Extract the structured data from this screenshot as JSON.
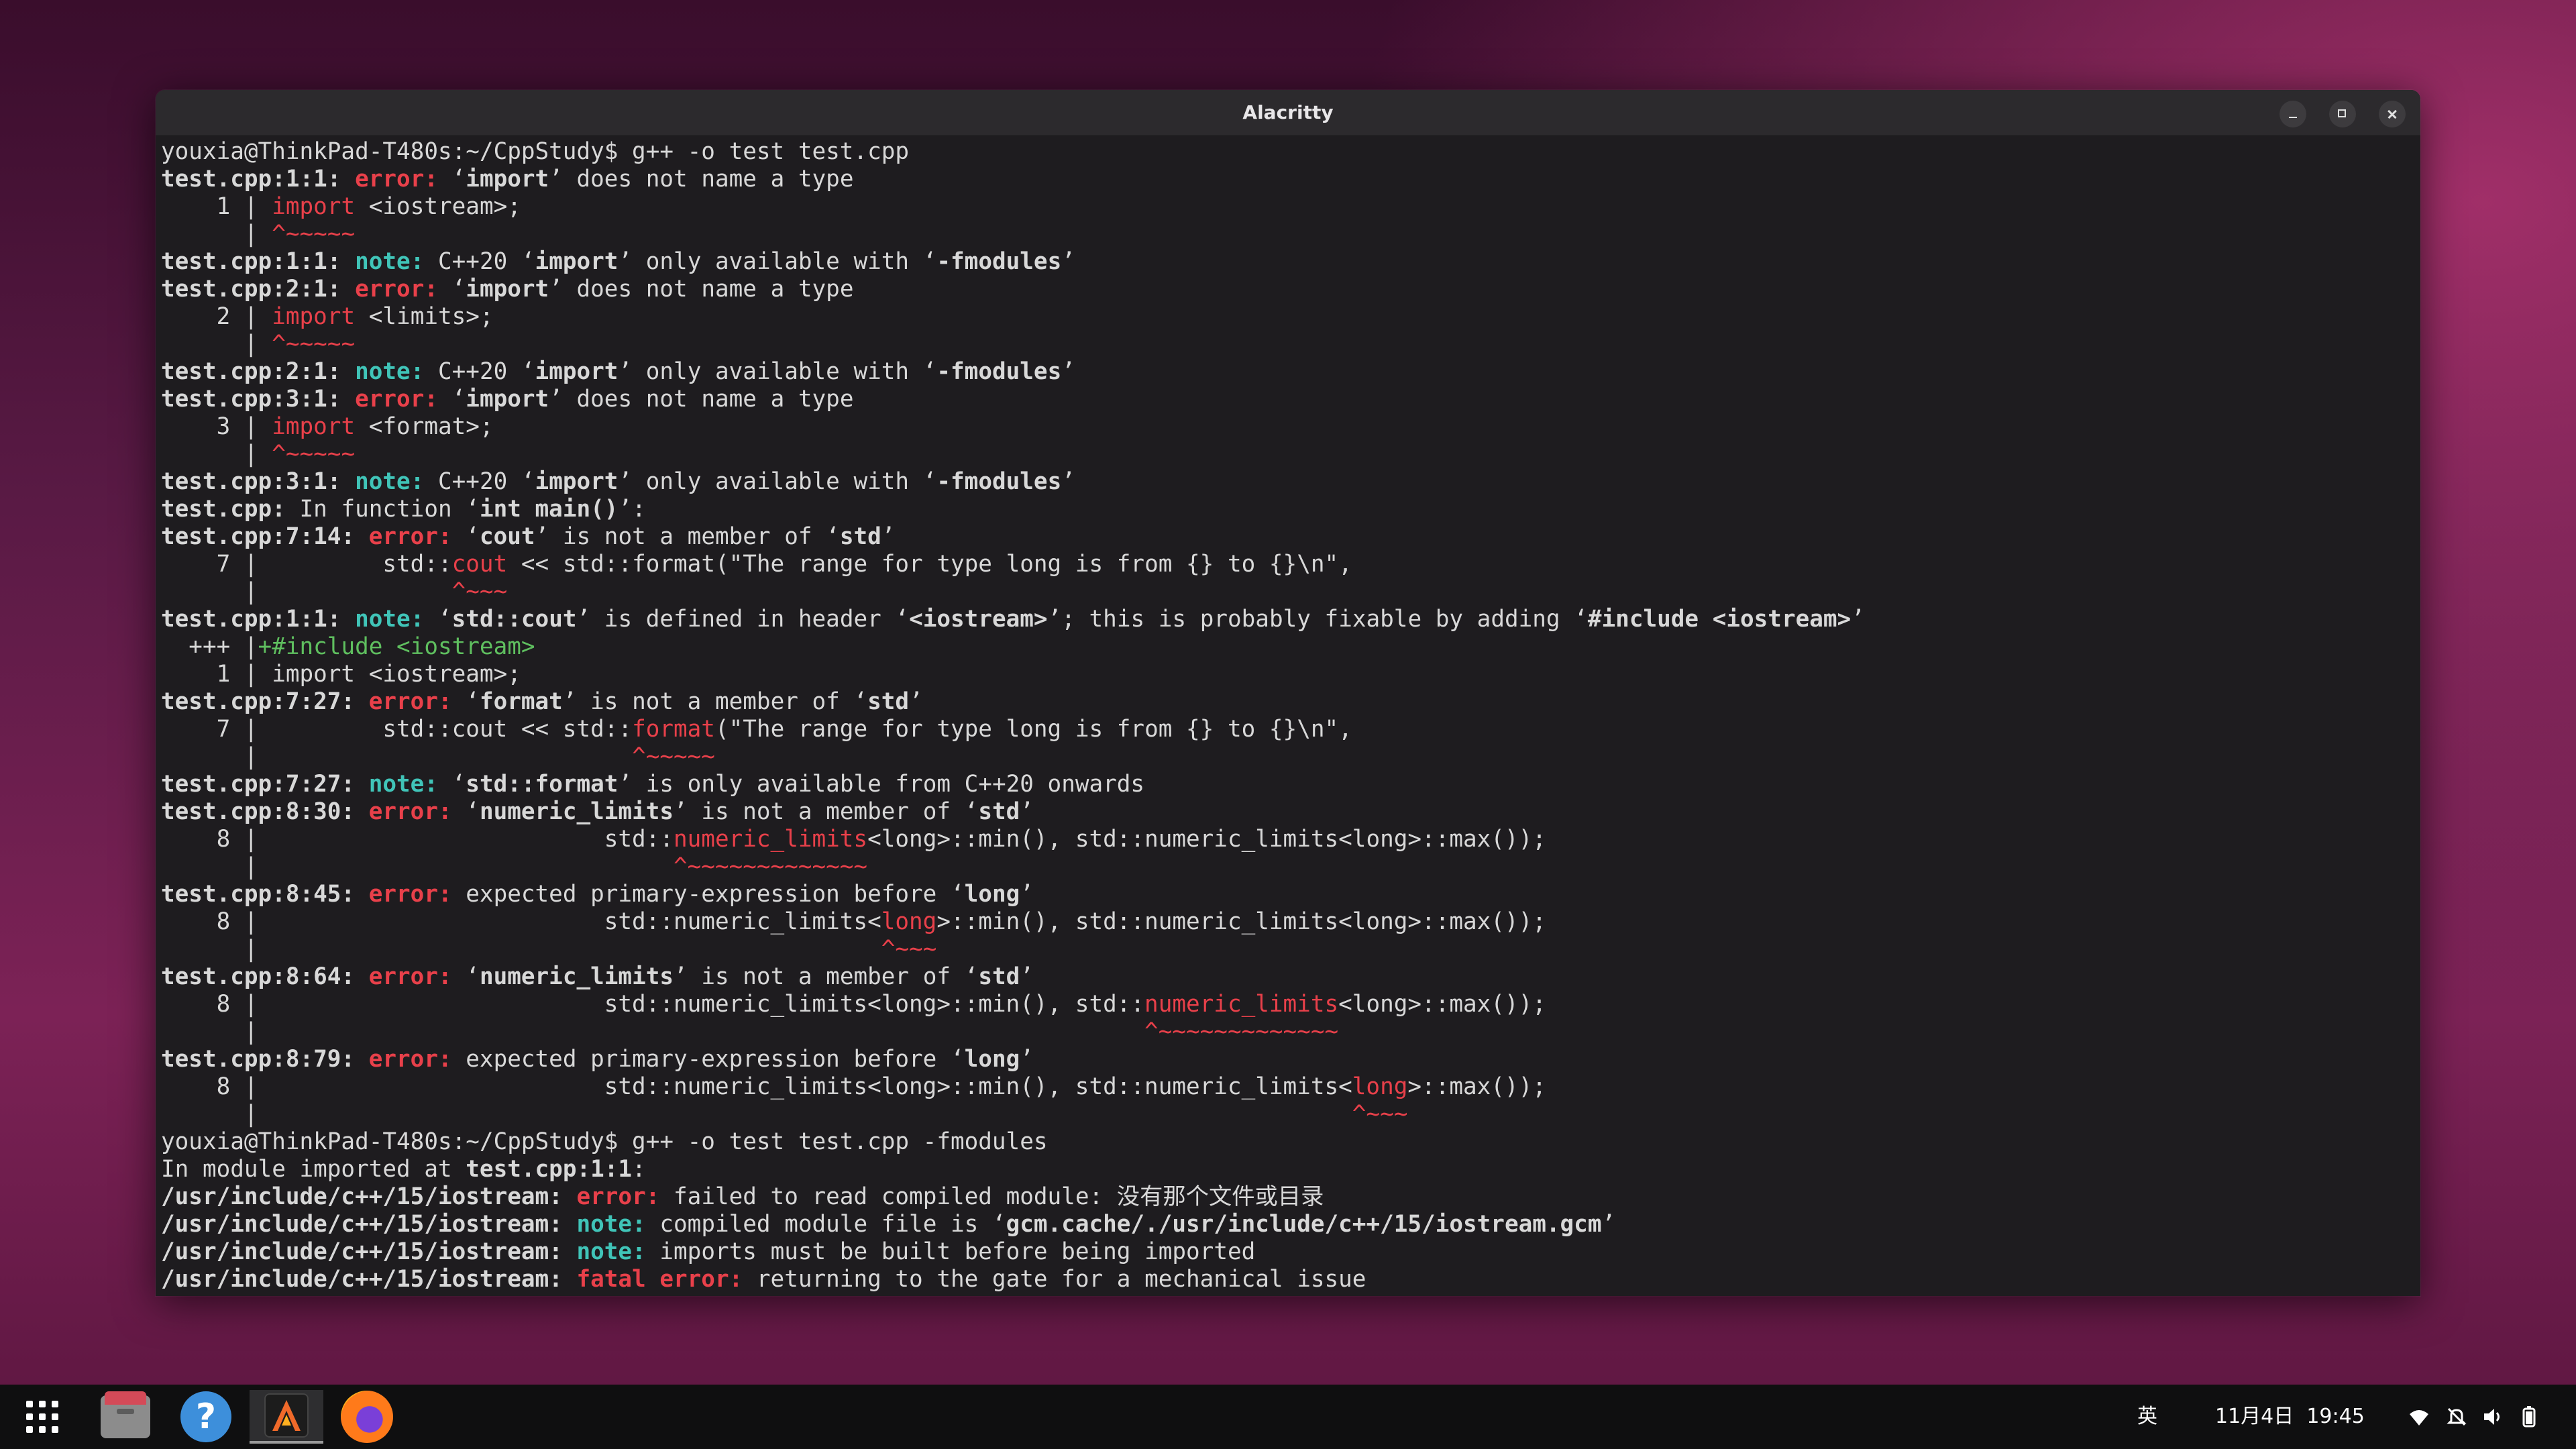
{
  "window": {
    "title": "Alacritty"
  },
  "terminal": {
    "colors": {
      "error": "#e8404a",
      "note": "#40c4b8",
      "fixit": "#5fbf5f",
      "text": "#d8d8d8"
    },
    "lines": [
      [
        {
          "t": "youxia@ThinkPad-T480s:~/CppStudy$ g++ -o test test.cpp"
        }
      ],
      [
        {
          "t": "test.cpp:1:1: ",
          "c": "bold"
        },
        {
          "t": "error: ",
          "c": "err"
        },
        {
          "t": "‘"
        },
        {
          "t": "import",
          "c": "bold"
        },
        {
          "t": "’ does not name a type"
        }
      ],
      [
        {
          "t": "    1 | "
        },
        {
          "t": "import",
          "c": "red"
        },
        {
          "t": " <iostream>;"
        }
      ],
      [
        {
          "t": "      | "
        },
        {
          "t": "^~~~~~",
          "c": "red"
        }
      ],
      [
        {
          "t": "test.cpp:1:1: ",
          "c": "bold"
        },
        {
          "t": "note: ",
          "c": "note"
        },
        {
          "t": "C++20 ‘"
        },
        {
          "t": "import",
          "c": "bold"
        },
        {
          "t": "’ only available with ‘"
        },
        {
          "t": "-fmodules",
          "c": "bold"
        },
        {
          "t": "’"
        }
      ],
      [
        {
          "t": "test.cpp:2:1: ",
          "c": "bold"
        },
        {
          "t": "error: ",
          "c": "err"
        },
        {
          "t": "‘"
        },
        {
          "t": "import",
          "c": "bold"
        },
        {
          "t": "’ does not name a type"
        }
      ],
      [
        {
          "t": "    2 | "
        },
        {
          "t": "import",
          "c": "red"
        },
        {
          "t": " <limits>;"
        }
      ],
      [
        {
          "t": "      | "
        },
        {
          "t": "^~~~~~",
          "c": "red"
        }
      ],
      [
        {
          "t": "test.cpp:2:1: ",
          "c": "bold"
        },
        {
          "t": "note: ",
          "c": "note"
        },
        {
          "t": "C++20 ‘"
        },
        {
          "t": "import",
          "c": "bold"
        },
        {
          "t": "’ only available with ‘"
        },
        {
          "t": "-fmodules",
          "c": "bold"
        },
        {
          "t": "’"
        }
      ],
      [
        {
          "t": "test.cpp:3:1: ",
          "c": "bold"
        },
        {
          "t": "error: ",
          "c": "err"
        },
        {
          "t": "‘"
        },
        {
          "t": "import",
          "c": "bold"
        },
        {
          "t": "’ does not name a type"
        }
      ],
      [
        {
          "t": "    3 | "
        },
        {
          "t": "import",
          "c": "red"
        },
        {
          "t": " <format>;"
        }
      ],
      [
        {
          "t": "      | "
        },
        {
          "t": "^~~~~~",
          "c": "red"
        }
      ],
      [
        {
          "t": "test.cpp:3:1: ",
          "c": "bold"
        },
        {
          "t": "note: ",
          "c": "note"
        },
        {
          "t": "C++20 ‘"
        },
        {
          "t": "import",
          "c": "bold"
        },
        {
          "t": "’ only available with ‘"
        },
        {
          "t": "-fmodules",
          "c": "bold"
        },
        {
          "t": "’"
        }
      ],
      [
        {
          "t": "test.cpp:",
          "c": "bold"
        },
        {
          "t": " In function ‘"
        },
        {
          "t": "int main()",
          "c": "bold"
        },
        {
          "t": "’:"
        }
      ],
      [
        {
          "t": "test.cpp:7:14: ",
          "c": "bold"
        },
        {
          "t": "error: ",
          "c": "err"
        },
        {
          "t": "‘"
        },
        {
          "t": "cout",
          "c": "bold"
        },
        {
          "t": "’ is not a member of ‘"
        },
        {
          "t": "std",
          "c": "bold"
        },
        {
          "t": "’"
        }
      ],
      [
        {
          "t": "    7 |         std::"
        },
        {
          "t": "cout",
          "c": "red"
        },
        {
          "t": " << std::format(\"The range for type long is from {} to {}\\n\","
        }
      ],
      [
        {
          "t": "      |              "
        },
        {
          "t": "^~~~",
          "c": "red"
        }
      ],
      [
        {
          "t": "test.cpp:1:1: ",
          "c": "bold"
        },
        {
          "t": "note: ",
          "c": "note"
        },
        {
          "t": "‘"
        },
        {
          "t": "std::cout",
          "c": "bold"
        },
        {
          "t": "’ is defined in header ‘"
        },
        {
          "t": "<iostream>",
          "c": "bold"
        },
        {
          "t": "’; this is probably fixable by adding ‘"
        },
        {
          "t": "#include <iostream>",
          "c": "bold"
        },
        {
          "t": "’"
        }
      ],
      [
        {
          "t": "  +++ |"
        },
        {
          "t": "+#include <iostream>",
          "c": "grn"
        }
      ],
      [
        {
          "t": "    1 | import <iostream>;"
        }
      ],
      [
        {
          "t": "test.cpp:7:27: ",
          "c": "bold"
        },
        {
          "t": "error: ",
          "c": "err"
        },
        {
          "t": "‘"
        },
        {
          "t": "format",
          "c": "bold"
        },
        {
          "t": "’ is not a member of ‘"
        },
        {
          "t": "std",
          "c": "bold"
        },
        {
          "t": "’"
        }
      ],
      [
        {
          "t": "    7 |         std::cout << std::"
        },
        {
          "t": "format",
          "c": "red"
        },
        {
          "t": "(\"The range for type long is from {} to {}\\n\","
        }
      ],
      [
        {
          "t": "      |                           "
        },
        {
          "t": "^~~~~~",
          "c": "red"
        }
      ],
      [
        {
          "t": "test.cpp:7:27: ",
          "c": "bold"
        },
        {
          "t": "note: ",
          "c": "note"
        },
        {
          "t": "‘"
        },
        {
          "t": "std::format",
          "c": "bold"
        },
        {
          "t": "’ is only available from C++20 onwards"
        }
      ],
      [
        {
          "t": "test.cpp:8:30: ",
          "c": "bold"
        },
        {
          "t": "error: ",
          "c": "err"
        },
        {
          "t": "‘"
        },
        {
          "t": "numeric_limits",
          "c": "bold"
        },
        {
          "t": "’ is not a member of ‘"
        },
        {
          "t": "std",
          "c": "bold"
        },
        {
          "t": "’"
        }
      ],
      [
        {
          "t": "    8 |                         std::"
        },
        {
          "t": "numeric_limits",
          "c": "red"
        },
        {
          "t": "<long>::min(), std::numeric_limits<long>::max());"
        }
      ],
      [
        {
          "t": "      |                              "
        },
        {
          "t": "^~~~~~~~~~~~~~",
          "c": "red"
        }
      ],
      [
        {
          "t": "test.cpp:8:45: ",
          "c": "bold"
        },
        {
          "t": "error: ",
          "c": "err"
        },
        {
          "t": "expected primary-expression before ‘"
        },
        {
          "t": "long",
          "c": "bold"
        },
        {
          "t": "’"
        }
      ],
      [
        {
          "t": "    8 |                         std::numeric_limits<"
        },
        {
          "t": "long",
          "c": "red"
        },
        {
          "t": ">::min(), std::numeric_limits<long>::max());"
        }
      ],
      [
        {
          "t": "      |                                             "
        },
        {
          "t": "^~~~",
          "c": "red"
        }
      ],
      [
        {
          "t": "test.cpp:8:64: ",
          "c": "bold"
        },
        {
          "t": "error: ",
          "c": "err"
        },
        {
          "t": "‘"
        },
        {
          "t": "numeric_limits",
          "c": "bold"
        },
        {
          "t": "’ is not a member of ‘"
        },
        {
          "t": "std",
          "c": "bold"
        },
        {
          "t": "’"
        }
      ],
      [
        {
          "t": "    8 |                         std::numeric_limits<long>::min(), std::"
        },
        {
          "t": "numeric_limits",
          "c": "red"
        },
        {
          "t": "<long>::max());"
        }
      ],
      [
        {
          "t": "      |                                                                "
        },
        {
          "t": "^~~~~~~~~~~~~~",
          "c": "red"
        }
      ],
      [
        {
          "t": "test.cpp:8:79: ",
          "c": "bold"
        },
        {
          "t": "error: ",
          "c": "err"
        },
        {
          "t": "expected primary-expression before ‘"
        },
        {
          "t": "long",
          "c": "bold"
        },
        {
          "t": "’"
        }
      ],
      [
        {
          "t": "    8 |                         std::numeric_limits<long>::min(), std::numeric_limits<"
        },
        {
          "t": "long",
          "c": "red"
        },
        {
          "t": ">::max());"
        }
      ],
      [
        {
          "t": "      |                                                                               "
        },
        {
          "t": "^~~~",
          "c": "red"
        }
      ],
      [
        {
          "t": "youxia@ThinkPad-T480s:~/CppStudy$ g++ -o test test.cpp -fmodules"
        }
      ],
      [
        {
          "t": "In module imported at "
        },
        {
          "t": "test.cpp:1:1",
          "c": "bold"
        },
        {
          "t": ":"
        }
      ],
      [
        {
          "t": "/usr/include/c++/15/iostream: ",
          "c": "bold"
        },
        {
          "t": "error: ",
          "c": "err"
        },
        {
          "t": "failed to read compiled module: 没有那个文件或目录"
        }
      ],
      [
        {
          "t": "/usr/include/c++/15/iostream: ",
          "c": "bold"
        },
        {
          "t": "note: ",
          "c": "note"
        },
        {
          "t": "compiled module file is ‘"
        },
        {
          "t": "gcm.cache/./usr/include/c++/15/iostream.gcm",
          "c": "bold"
        },
        {
          "t": "’"
        }
      ],
      [
        {
          "t": "/usr/include/c++/15/iostream: ",
          "c": "bold"
        },
        {
          "t": "note: ",
          "c": "note"
        },
        {
          "t": "imports must be built before being imported"
        }
      ],
      [
        {
          "t": "/usr/include/c++/15/iostream: ",
          "c": "bold"
        },
        {
          "t": "fatal error: ",
          "c": "err"
        },
        {
          "t": "returning to the gate for a mechanical issue"
        }
      ]
    ]
  },
  "taskbar": {
    "apps": [
      {
        "name": "apps-grid-icon"
      },
      {
        "name": "files-icon"
      },
      {
        "name": "help-icon",
        "glyph": "?"
      },
      {
        "name": "alacritty-icon",
        "active": true
      },
      {
        "name": "firefox-icon"
      }
    ],
    "input_method": "英",
    "datetime": "11月4日  19:45",
    "indicators": [
      "wifi-icon",
      "notifications-off-icon",
      "volume-icon",
      "battery-icon"
    ]
  }
}
